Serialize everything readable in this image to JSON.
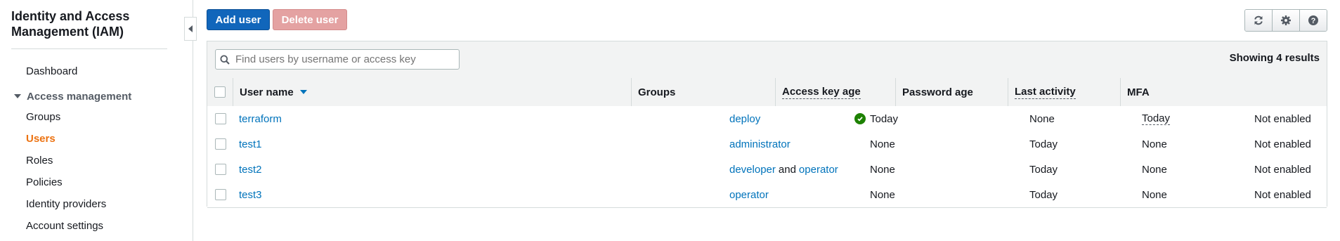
{
  "sidebar": {
    "title": "Identity and Access Management (IAM)",
    "dashboard": "Dashboard",
    "section": "Access management",
    "items": [
      {
        "label": "Groups",
        "active": false
      },
      {
        "label": "Users",
        "active": true
      },
      {
        "label": "Roles",
        "active": false
      },
      {
        "label": "Policies",
        "active": false
      },
      {
        "label": "Identity providers",
        "active": false
      },
      {
        "label": "Account settings",
        "active": false
      }
    ]
  },
  "toolbar": {
    "add_label": "Add user",
    "delete_label": "Delete user",
    "icons": [
      "refresh-icon",
      "settings-icon",
      "help-icon"
    ]
  },
  "table": {
    "search_placeholder": "Find users by username or access key",
    "results": "Showing 4 results",
    "columns": [
      "User name",
      "Groups",
      "Access key age",
      "Password age",
      "Last activity",
      "MFA"
    ],
    "rows": [
      {
        "user": "terraform",
        "groups": [
          "deploy"
        ],
        "key_age": "Today",
        "password_age": "None",
        "last_activity": "Today",
        "mfa": "Not enabled"
      },
      {
        "user": "test1",
        "groups": [
          "administrator"
        ],
        "key_age": "None",
        "password_age": "Today",
        "last_activity": "None",
        "mfa": "Not enabled"
      },
      {
        "user": "test2",
        "groups": [
          "developer",
          "operator"
        ],
        "group_joiner": "and",
        "key_age": "None",
        "password_age": "Today",
        "last_activity": "None",
        "mfa": "Not enabled"
      },
      {
        "user": "test3",
        "groups": [
          "operator"
        ],
        "key_age": "None",
        "password_age": "Today",
        "last_activity": "None",
        "mfa": "Not enabled"
      }
    ]
  },
  "colors": {
    "primary": "#1166bb",
    "link": "#0073bb",
    "active_nav": "#ec7211",
    "success": "#1d8102",
    "danger_disabled": "#e4a2a2"
  }
}
